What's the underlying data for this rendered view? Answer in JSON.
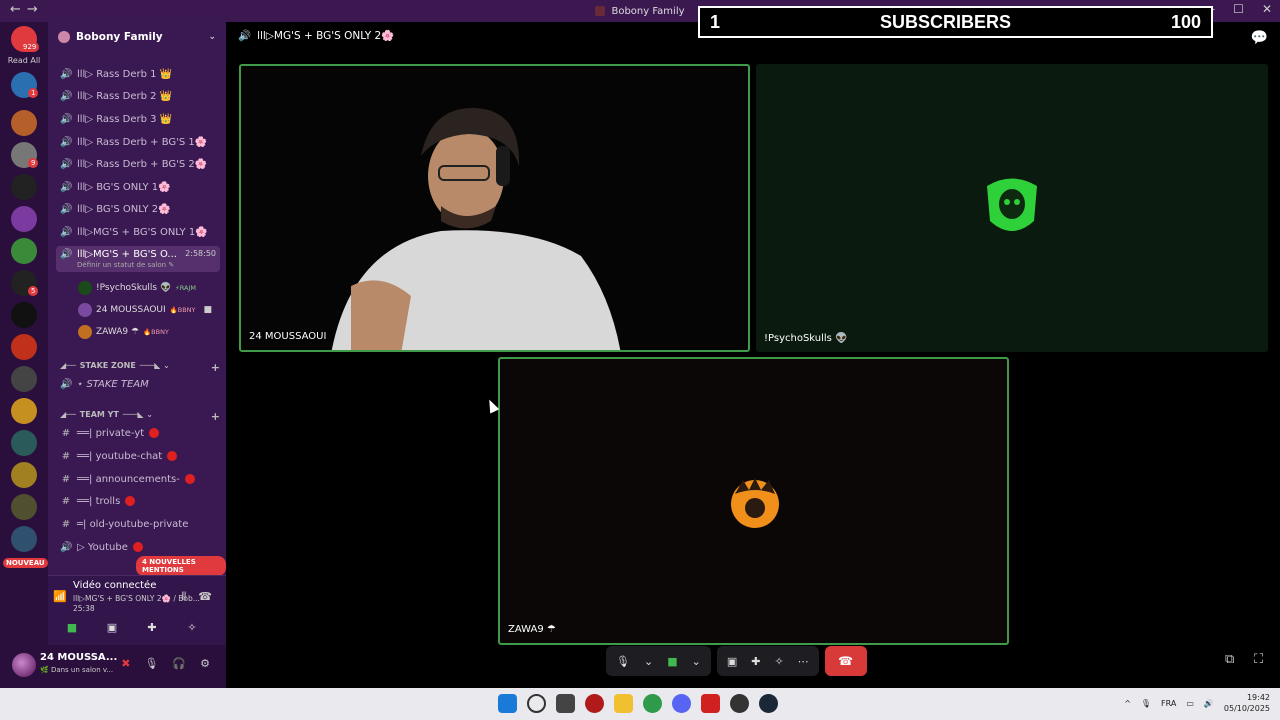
{
  "titlebar": {
    "app_title": "Bobony Family",
    "nav": "←→"
  },
  "overlay": {
    "left": "1",
    "label": "SUBSCRIBERS",
    "right": "100"
  },
  "rail": {
    "top_badge": "929",
    "read_all": "Read All",
    "badges": [
      "1",
      "9",
      "5"
    ],
    "new_label": "NOUVEAU"
  },
  "sidebar": {
    "guild_name": "Bobony Family",
    "channels": [
      {
        "label": "lll▷ Rass Derb 1 👑"
      },
      {
        "label": "lll▷ Rass Derb 2 👑"
      },
      {
        "label": "lll▷ Rass Derb 3 👑"
      },
      {
        "label": "lll▷ Rass Derb + BG'S 1🌸"
      },
      {
        "label": "lll▷ Rass Derb + BG'S 2🌸"
      },
      {
        "label": "lll▷ BG'S ONLY 1🌸"
      },
      {
        "label": "lll▷ BG'S ONLY 2🌸"
      },
      {
        "label": "lll▷MG'S + BG'S ONLY 1🌸"
      }
    ],
    "active_channel": {
      "label": "lll▷MG'S + BG'S O...",
      "time": "2:58:50",
      "status": "Définir un statut de salon ✎"
    },
    "members": [
      {
        "name": "!PsychoSkulls 👽",
        "tag": "⚡RAJM"
      },
      {
        "name": "24 MOUSSAOUI",
        "tag": "🔥BBNY"
      },
      {
        "name": "ZAWA9 ☂",
        "tag": "🔥BBNY"
      }
    ],
    "cat_stake": "STAKE ZONE",
    "stake_team": "⋆ STAKE TEAM",
    "cat_team_yt": "TEAM YT",
    "text_channels": [
      {
        "label": "══| private-yt"
      },
      {
        "label": "══| youtube-chat"
      },
      {
        "label": "══| announcements-"
      },
      {
        "label": "══| trolls"
      },
      {
        "label": "═| old-youtube-private"
      },
      {
        "label": "▷ Youtube"
      }
    ],
    "mentions": "4 NOUVELLES MENTIONS"
  },
  "voice": {
    "title": "Vidéo connectée",
    "sub": "lll▷MG'S + BG'S ONLY 2🌸 / Bob...",
    "time": "25:38"
  },
  "user": {
    "name": "24 MOUSSA...",
    "status": "🌿 Dans un salon v..."
  },
  "call": {
    "channel": "lll▷MG'S + BG'S ONLY 2🌸",
    "tiles": [
      {
        "name": "24 MOUSSAOUI"
      },
      {
        "name": "!PsychoSkulls 👽"
      },
      {
        "name": "ZAWA9 ☂"
      }
    ]
  },
  "taskbar": {
    "lang": "FRA",
    "time": "19:42",
    "date": "05/10/2025"
  },
  "colors": {
    "sidebar_bg": "#3a1851",
    "rail_bg": "#2a0f3c",
    "speaking_border": "#3f9a4a",
    "hangup": "#d83a3a"
  }
}
